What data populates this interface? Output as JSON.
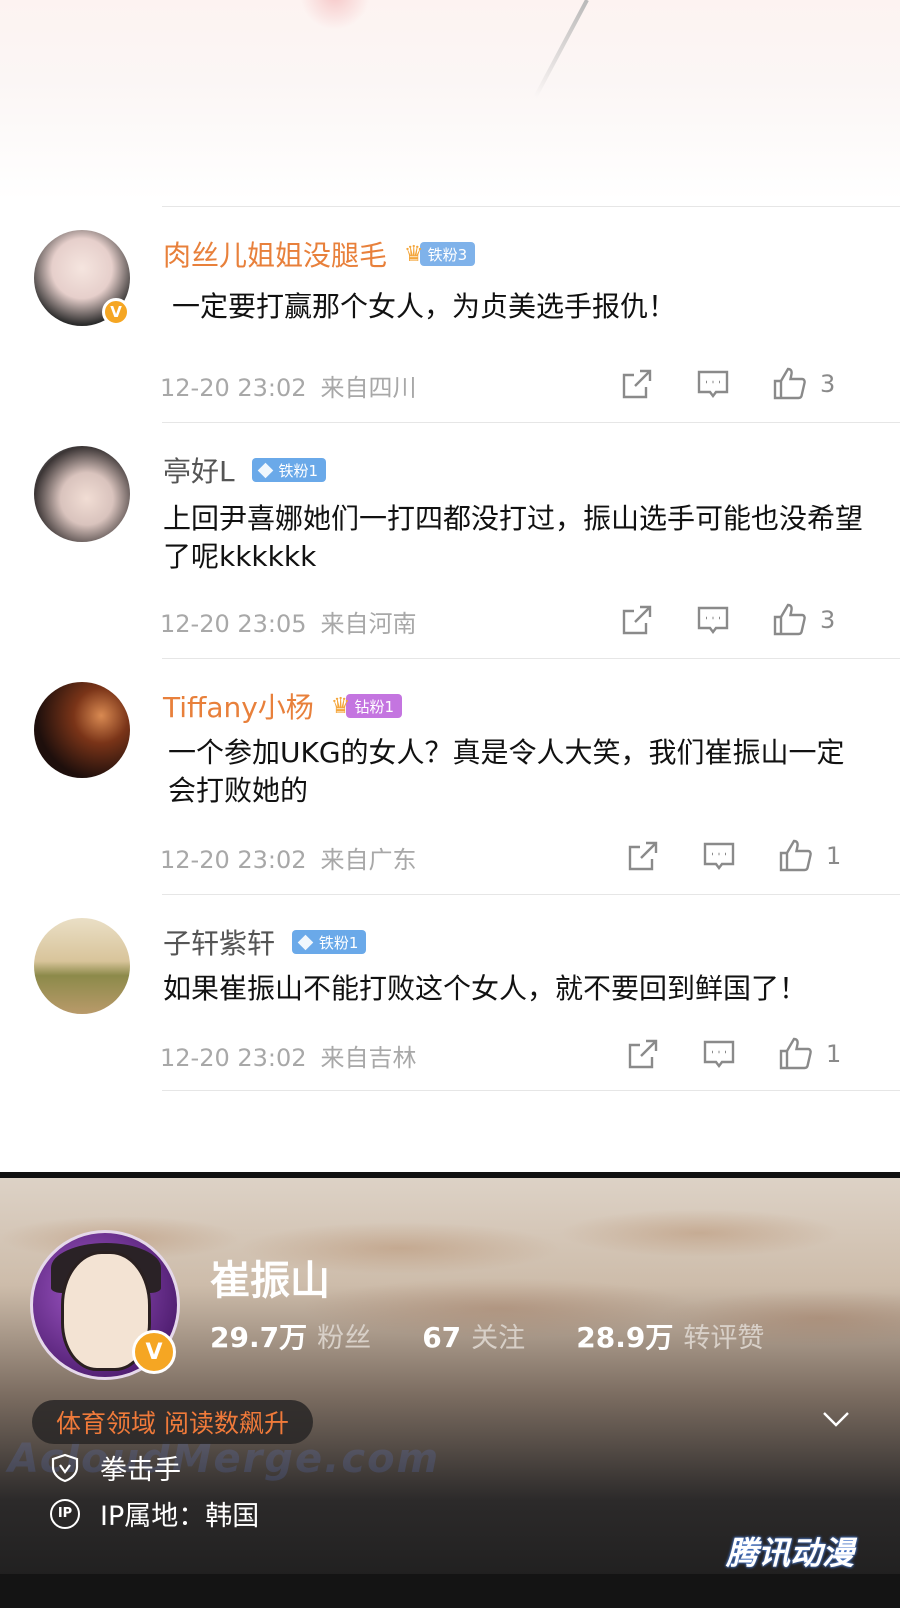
{
  "comments": [
    {
      "name": "肉丝儿姐姐没腿毛",
      "name_color": "orange",
      "badge": {
        "type": "crown",
        "label": "铁粉3"
      },
      "verified": true,
      "text": "一定要打赢那个女人，为贞美选手报仇！",
      "time": "12-20 23:02",
      "location": "来自四川",
      "likes": "3"
    },
    {
      "name": "亭好L",
      "name_color": "gray",
      "badge": {
        "type": "diamond",
        "label": "铁粉1"
      },
      "verified": false,
      "text": "上回尹喜娜她们一打四都没打过，振山选手可能也没希望了呢kkkkkk",
      "time": "12-20 23:05",
      "location": "来自河南",
      "likes": "3"
    },
    {
      "name": "Tiffany小杨",
      "name_color": "orange",
      "badge": {
        "type": "crown",
        "label": "钻粉1"
      },
      "verified": false,
      "text": "一个参加UKG的女人？真是令人大笑，我们崔振山一定会打败她的",
      "time": "12-20 23:02",
      "location": "来自广东",
      "likes": "1"
    },
    {
      "name": "子轩紫轩",
      "name_color": "gray",
      "badge": {
        "type": "diamond",
        "label": "铁粉1"
      },
      "verified": false,
      "text": "如果崔振山不能打败这个女人，就不要回到鲜国了！",
      "time": "12-20 23:02",
      "location": "来自吉林",
      "likes": "1"
    }
  ],
  "profile": {
    "name": "崔振山",
    "stats": [
      {
        "value": "29.7万",
        "label": "粉丝"
      },
      {
        "value": "67",
        "label": "关注"
      },
      {
        "value": "28.9万",
        "label": "转评赞"
      }
    ],
    "tag": "体育领域 阅读数飙升",
    "occupation": "拳击手",
    "ip": "IP属地：韩国",
    "ip_icon_text": "IP"
  },
  "watermarks": {
    "left": "AcloudMerge.com",
    "right": "腾讯动漫"
  },
  "colors": {
    "orange_name": "#e8803b",
    "verified": "#f5a623",
    "iron_badge": "#6aa9e9",
    "drill_badge": "#c475e0"
  }
}
